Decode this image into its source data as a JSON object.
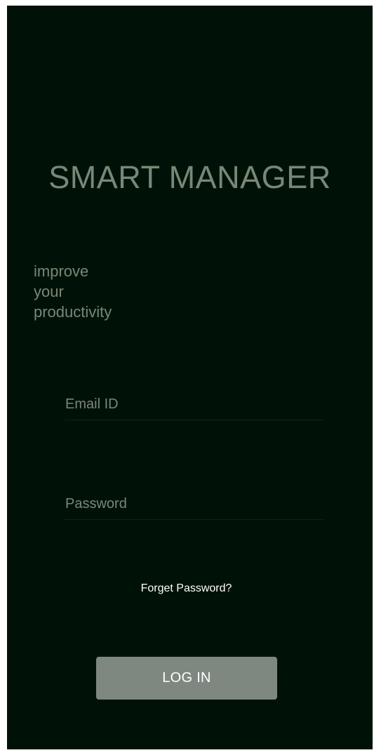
{
  "app": {
    "title": "SMART MANAGER"
  },
  "tagline": {
    "lines": [
      "improve",
      "your",
      "productivity"
    ]
  },
  "form": {
    "email_placeholder": "Email ID",
    "email_value": "",
    "password_placeholder": "Password",
    "password_value": "",
    "forget_label": "Forget Password?",
    "login_label": "LOG IN"
  },
  "colors": {
    "background": "#001208",
    "muted_text": "#7a8777",
    "button": "#7f8880",
    "link": "#ffffff"
  }
}
